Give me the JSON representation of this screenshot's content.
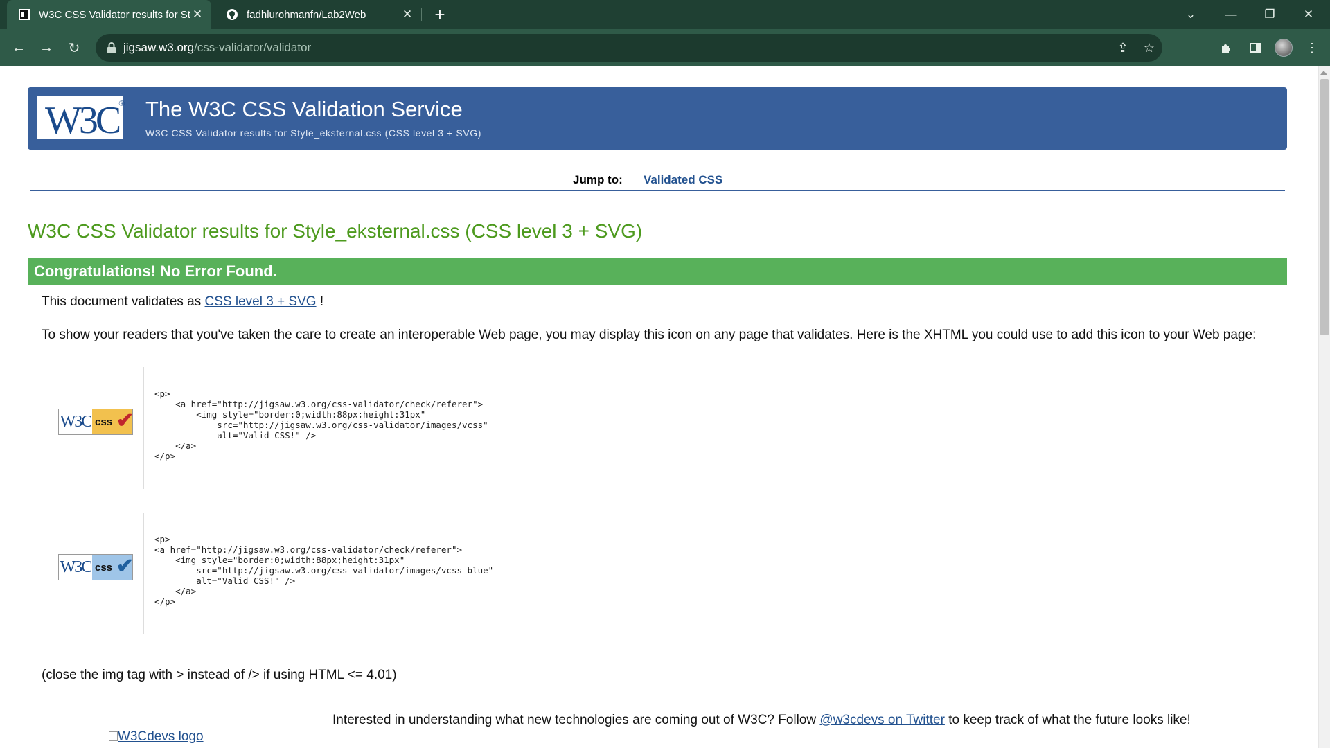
{
  "browser": {
    "tabs": [
      {
        "title": "W3C CSS Validator results for Style_eksternal.css (CSS level 3 + SVG)",
        "active": true,
        "favicon": "w3c-favicon"
      },
      {
        "title": "fadhlurohmanfn/Lab2Web",
        "active": false,
        "favicon": "github-icon"
      }
    ],
    "new_tab": "+",
    "url_host": "jigsaw.w3.org",
    "url_path": "/css-validator/validator"
  },
  "page": {
    "banner_title": "The W3C CSS Validation Service",
    "banner_subtitle": "W3C CSS Validator results for Style_eksternal.css (CSS level 3 + SVG)",
    "logo_text": "W3C",
    "jump_label": "Jump to:",
    "jump_link": "Validated CSS",
    "heading": "W3C CSS Validator results for Style_eksternal.css (CSS level 3 + SVG)",
    "congrats": "Congratulations! No Error Found.",
    "validates_prefix": "This document validates as ",
    "validates_link": "CSS level 3 + SVG",
    "validates_suffix": " !",
    "icon_paragraph": "To show your readers that you've taken the care to create an interoperable Web page, you may display this icon on any page that validates. Here is the XHTML you could use to add this icon to your Web page:",
    "badges": [
      {
        "w3c": "W3C",
        "label": "css",
        "code": "<p>\n    <a href=\"http://jigsaw.w3.org/css-validator/check/referer\">\n        <img style=\"border:0;width:88px;height:31px\"\n            src=\"http://jigsaw.w3.org/css-validator/images/vcss\"\n            alt=\"Valid CSS!\" />\n    </a>\n</p>"
      },
      {
        "w3c": "W3C",
        "label": "css",
        "code": "<p>\n<a href=\"http://jigsaw.w3.org/css-validator/check/referer\">\n    <img style=\"border:0;width:88px;height:31px\"\n        src=\"http://jigsaw.w3.org/css-validator/images/vcss-blue\"\n        alt=\"Valid CSS!\" />\n    </a>\n</p>"
      }
    ],
    "close_tag_note": "(close the img tag with > instead of /> if using HTML <= 4.01)",
    "twitter_prefix": "Interested in understanding what new technologies are coming out of W3C? Follow ",
    "twitter_link": "@w3cdevs on Twitter",
    "twitter_suffix": " to keep track of what the future looks like!",
    "w3cdevs_logo_alt": "W3Cdevs logo"
  },
  "colors": {
    "chrome_dark": "#1f4033",
    "chrome_toolbar": "#2f5a48",
    "banner": "#385f9b",
    "heading_green": "#4d9a1e",
    "congrats_green": "#58b15a",
    "link": "#22518f",
    "badge_gold": "#f2c14e",
    "badge_blue": "#9fc5e8"
  }
}
